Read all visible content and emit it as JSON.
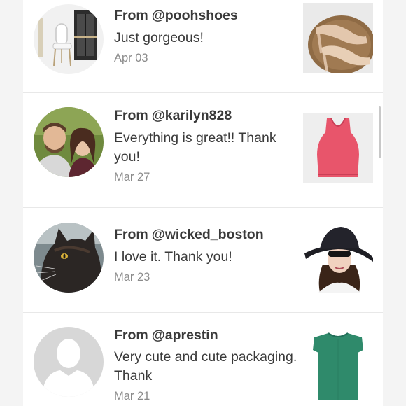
{
  "feed": {
    "from_prefix": "From",
    "reviews": [
      {
        "handle": "@poohshoes",
        "message": "Just gorgeous!",
        "date": "Apr 03",
        "avatar_icon": "furniture-avatar-photo",
        "item_icon": "nude-heels-photo"
      },
      {
        "handle": "@karilyn828",
        "message": "Everything is great!! Thank you!",
        "date": "Mar 27",
        "avatar_icon": "couple-avatar-photo",
        "item_icon": "pink-tank-top-photo"
      },
      {
        "handle": "@wicked_boston",
        "message": "I love it. Thank you!",
        "date": "Mar 23",
        "avatar_icon": "black-cat-avatar-photo",
        "item_icon": "woman-sun-hat-photo"
      },
      {
        "handle": "@aprestin",
        "message": "Very cute and cute packaging. Thank",
        "date": "Mar 21",
        "avatar_icon": "default-avatar-icon",
        "item_icon": "green-top-photo"
      }
    ]
  },
  "colors": {
    "text": "#3a3a3a",
    "muted": "#8a8a8a",
    "divider": "#e8e8e8",
    "background": "#f4f4f4"
  }
}
